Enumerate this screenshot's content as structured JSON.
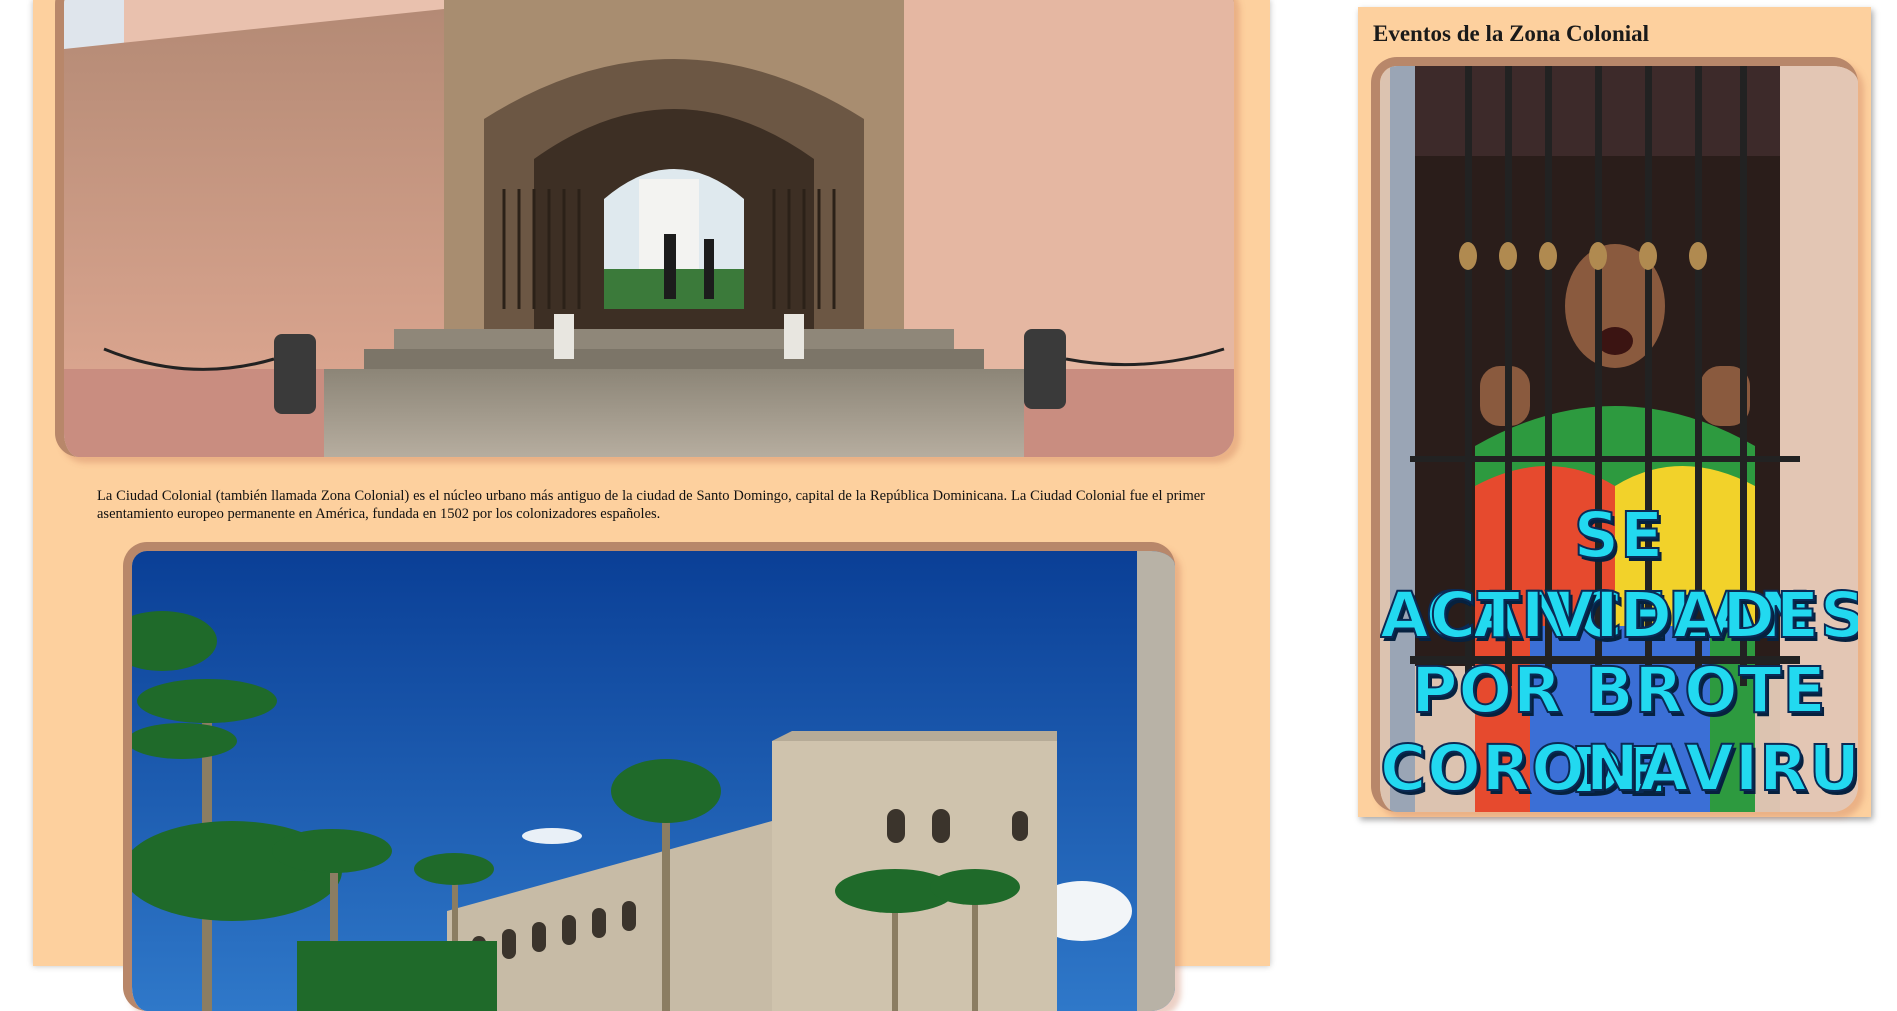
{
  "main": {
    "gate_image_alt": "Puerta de la Misericordia, Zona Colonial",
    "caption": "La Ciudad Colonial (también llamada Zona Colonial) es el núcleo urbano más antiguo de la ciudad de Santo Domingo, capital de la República Dominicana. La Ciudad Colonial fue el primer asentamiento europeo permanente en América, fundada en 1502 por los colonizadores españoles.",
    "alcazar_image_alt": "Alcázar de Colón"
  },
  "sidebar": {
    "title": "Eventos de la Zona Colonial",
    "event_lines": [
      "SE CANCELAN",
      "ACTIVIDADES",
      "POR BROTE DE",
      "CORONAVIRUS"
    ]
  },
  "colors": {
    "panel": "#fdd09e",
    "frame_border": "#b8876a",
    "event_text": "#22d9f0"
  }
}
